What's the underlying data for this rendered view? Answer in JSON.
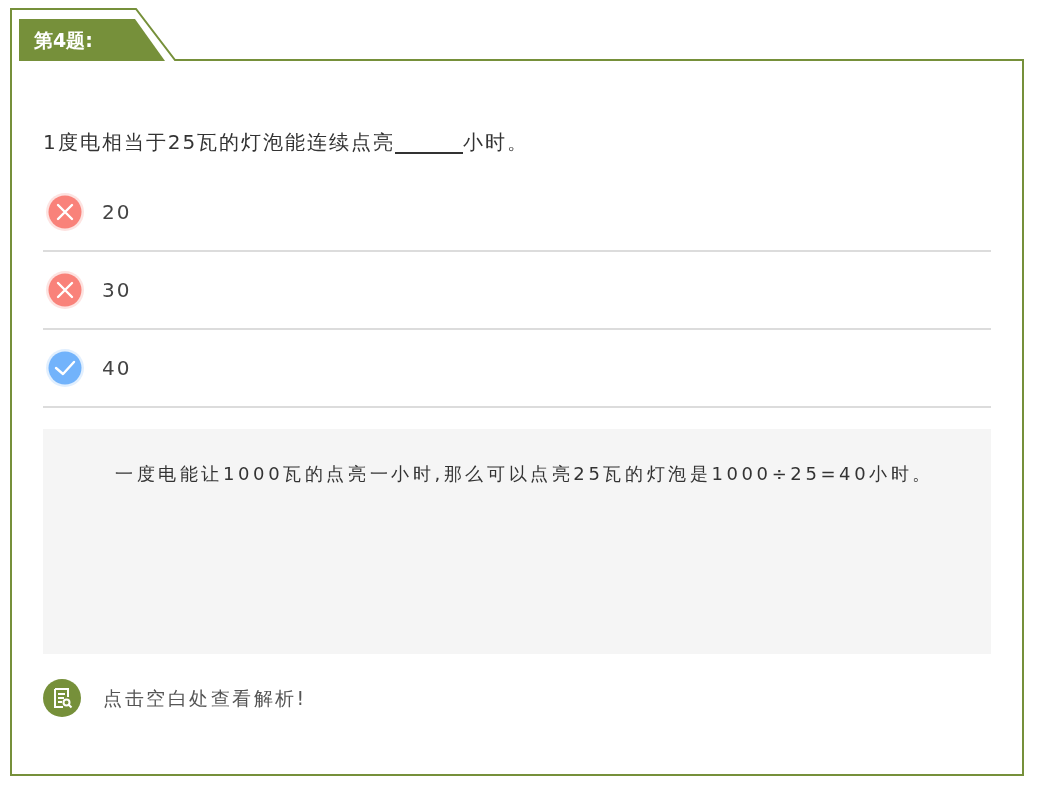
{
  "question_label": "第4题:",
  "question": {
    "before": "1度电相当于25瓦的灯泡能连续点亮",
    "after": "小时。"
  },
  "options": [
    {
      "text": "20",
      "kind": "wrong"
    },
    {
      "text": "30",
      "kind": "wrong"
    },
    {
      "text": "40",
      "kind": "correct"
    }
  ],
  "explanation": "一度电能让1000瓦的点亮一小时,那么可以点亮25瓦的灯泡是1000÷25=40小时。",
  "hint": "点击空白处查看解析!"
}
